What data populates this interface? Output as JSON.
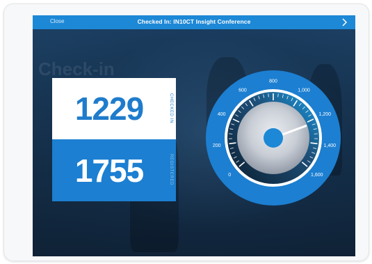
{
  "topbar": {
    "close_label": "Close",
    "title": "Checked In: IN10CT Insight Conference",
    "next_icon": "chevron-right-icon"
  },
  "background": {
    "sign_text": "Check-in"
  },
  "stats": {
    "checked_in": {
      "value": "1229",
      "label": "CHECKED IN"
    },
    "registered": {
      "value": "1755",
      "label": "REGISTERED"
    }
  },
  "gauge": {
    "min": 0,
    "max": 1600,
    "value": 1229,
    "tick_labels": [
      "0",
      "200",
      "400",
      "600",
      "800",
      "1,000",
      "1,200",
      "1,400",
      "1,600"
    ],
    "colors": {
      "ring": "#1c7fd1",
      "inner_ring": "#2e9ae6",
      "face_light": "#c9ced6",
      "face_dark": "#1f3a52",
      "hub": "#1d88d6"
    }
  },
  "colors": {
    "accent": "#1d88d6",
    "stat_dark": "#1c7fd1"
  }
}
